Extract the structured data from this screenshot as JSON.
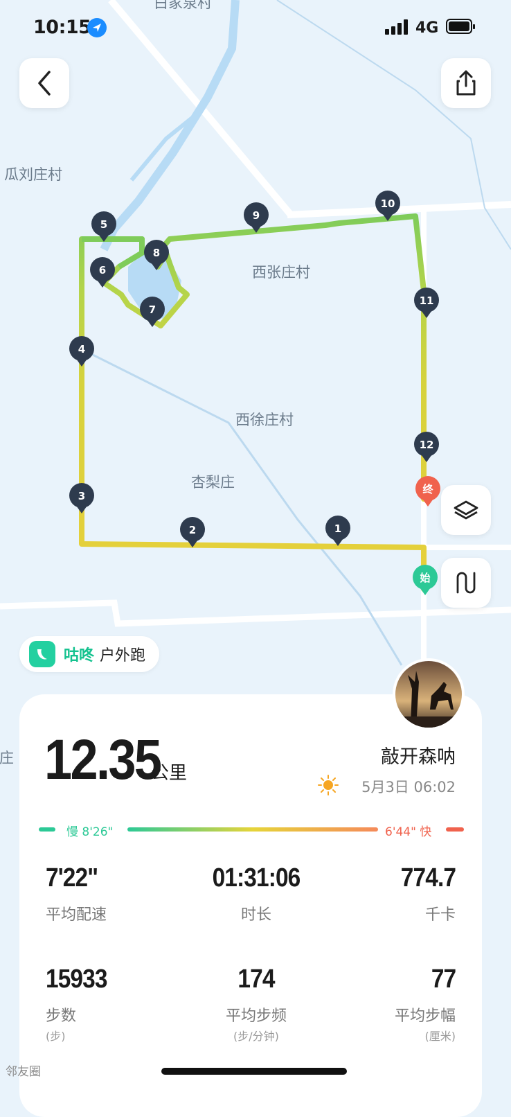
{
  "status_bar": {
    "time": "10:15",
    "network": "4G"
  },
  "map": {
    "place_labels": [
      "白家泉村",
      "瓜刘庄村",
      "西张庄村",
      "西徐庄村",
      "杏梨庄",
      "刘庄"
    ],
    "km_markers": [
      "1",
      "2",
      "3",
      "4",
      "5",
      "6",
      "7",
      "8",
      "9",
      "10",
      "11",
      "12"
    ],
    "start_label": "始",
    "end_label": "终"
  },
  "activity": {
    "brand": "咕咚",
    "type": "户外跑"
  },
  "summary": {
    "distance": "12.35",
    "distance_unit": "公里",
    "username": "敲开森呐",
    "date": "5月3日 06:02"
  },
  "pace_legend": {
    "slow": "慢 8'26\"",
    "fast": "6'44\" 快"
  },
  "stats": [
    {
      "value": "7'22\"",
      "label": "平均配速",
      "sub": ""
    },
    {
      "value": "01:31:06",
      "label": "时长",
      "sub": ""
    },
    {
      "value": "774.7",
      "label": "千卡",
      "sub": ""
    },
    {
      "value": "15933",
      "label": "步数",
      "sub": "(步)"
    },
    {
      "value": "174",
      "label": "平均步频",
      "sub": "(步/分钟)"
    },
    {
      "value": "77",
      "label": "平均步幅",
      "sub": "(厘米)"
    }
  ],
  "watermark": "邻友圈",
  "colors": {
    "route_slow": "#2cc996",
    "route_fast": "#f0624d",
    "marker": "#2e3b4e",
    "map_bg": "#e9f3fb",
    "water": "#b7dbf5"
  }
}
